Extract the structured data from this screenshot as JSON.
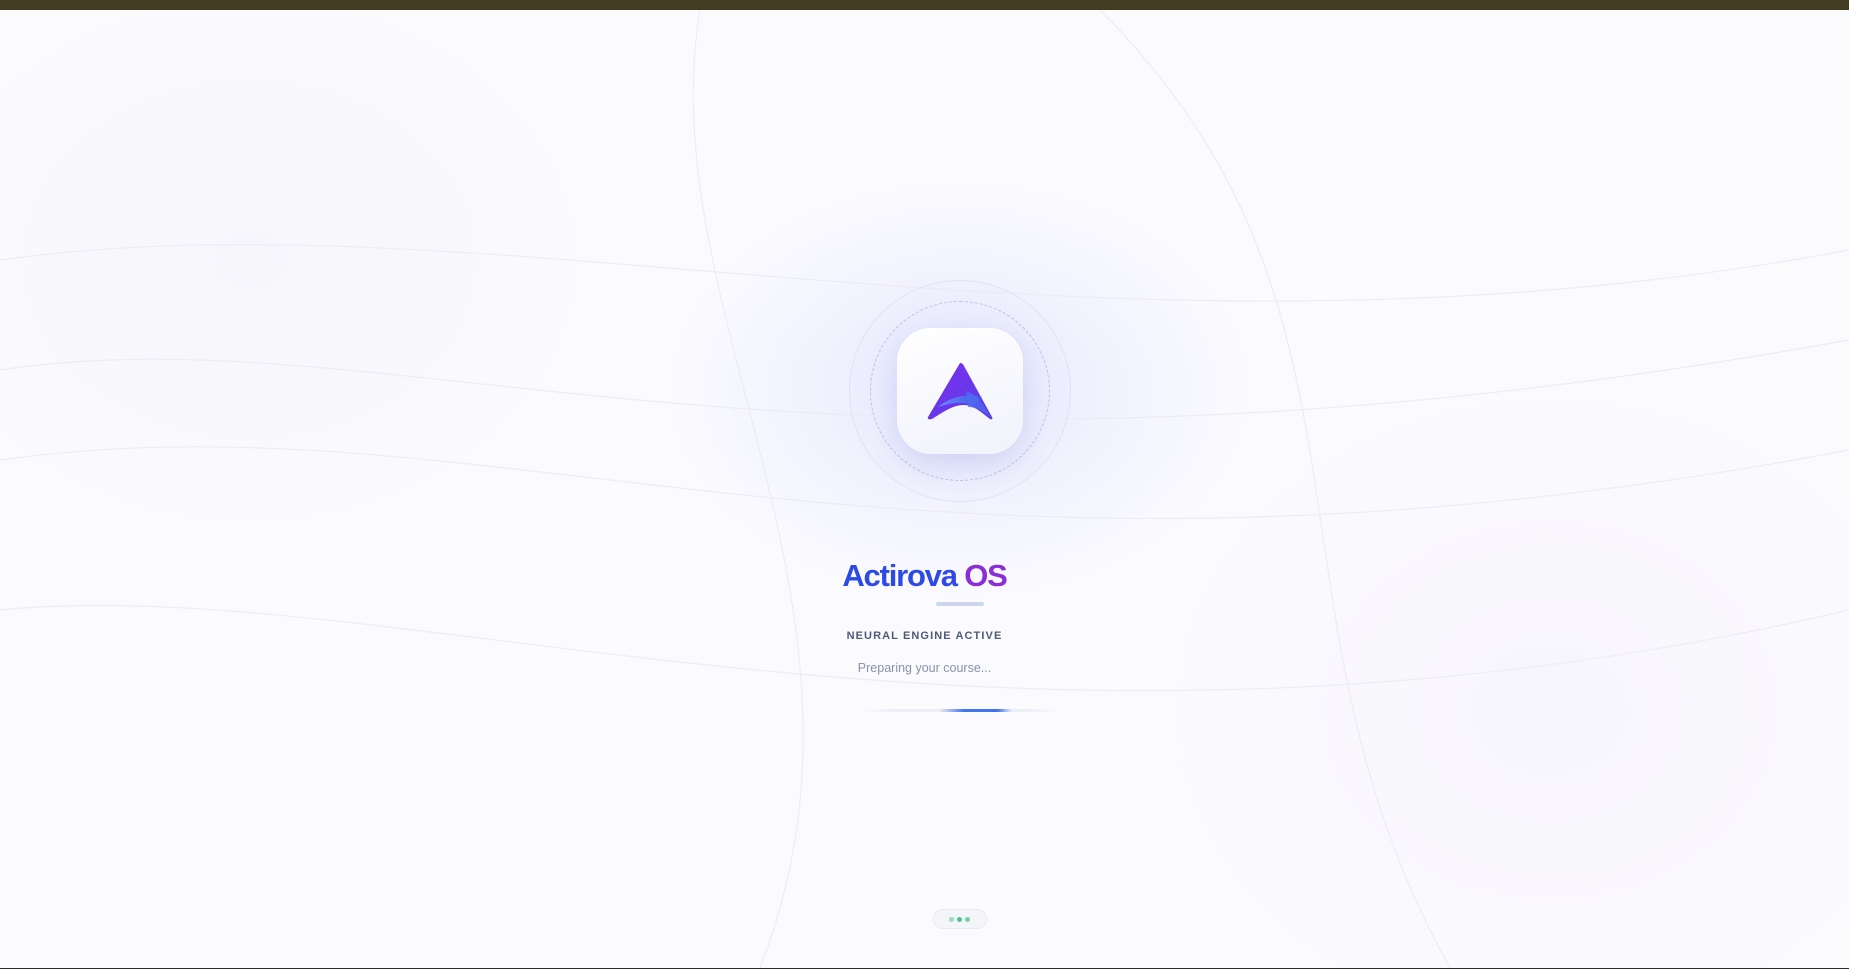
{
  "app": {
    "brand_part1": "Actirova",
    "brand_part2": "OS",
    "status_label": "NEURAL ENGINE ACTIVE",
    "loading_message": "Preparing your course...",
    "progress_fraction": 0.38
  },
  "icons": {
    "logo": "actirova-a-logo-icon",
    "loading_indicator": "three-dots-loading-icon"
  },
  "colors": {
    "brand_blue": "#2d4ae6",
    "brand_purple": "#8a2fd6",
    "progress": "#3f74ee",
    "dots": "#4cc38a",
    "top_bar": "#423c22"
  }
}
